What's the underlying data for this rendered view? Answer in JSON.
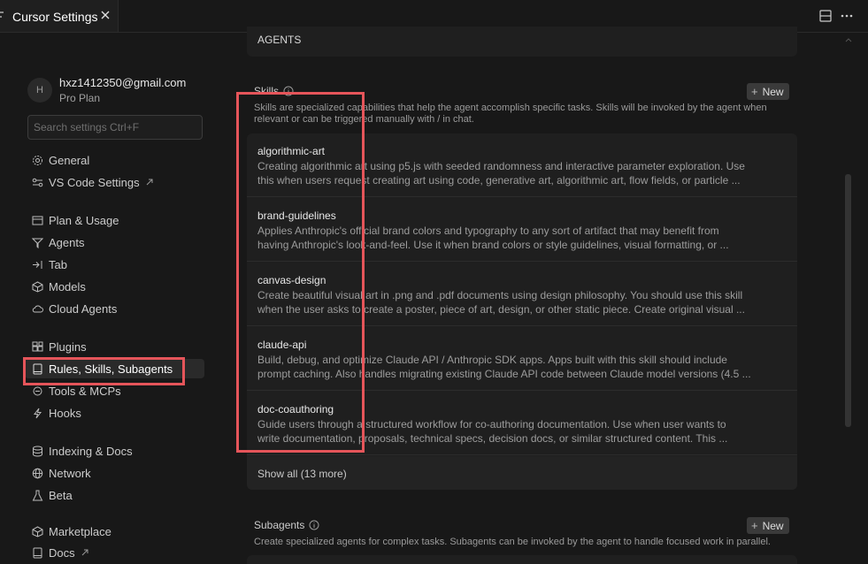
{
  "tab": {
    "title": "Cursor Settings"
  },
  "user": {
    "avatar_initial": "H",
    "email": "hxz1412350@gmail.com",
    "plan": "Pro Plan"
  },
  "search": {
    "placeholder": "Search settings Ctrl+F"
  },
  "sidebar": {
    "items": [
      {
        "label": "General",
        "icon": "gear-icon"
      },
      {
        "label": "VS Code Settings",
        "icon": "vscode-settings-icon"
      },
      {
        "label": "Plan & Usage",
        "icon": "plan-icon"
      },
      {
        "label": "Agents",
        "icon": "agents-icon"
      },
      {
        "label": "Tab",
        "icon": "tab-icon"
      },
      {
        "label": "Models",
        "icon": "cube-icon"
      },
      {
        "label": "Cloud Agents",
        "icon": "cloud-icon"
      },
      {
        "label": "Plugins",
        "icon": "plugins-icon"
      },
      {
        "label": "Rules, Skills, Subagents",
        "icon": "book-icon"
      },
      {
        "label": "Tools & MCPs",
        "icon": "tools-icon"
      },
      {
        "label": "Hooks",
        "icon": "hooks-icon"
      },
      {
        "label": "Indexing & Docs",
        "icon": "database-icon"
      },
      {
        "label": "Network",
        "icon": "globe-icon"
      },
      {
        "label": "Beta",
        "icon": "flask-icon"
      },
      {
        "label": "Marketplace",
        "icon": "marketplace-icon"
      },
      {
        "label": "Docs",
        "icon": "docs-icon"
      }
    ]
  },
  "main": {
    "agents_card": {
      "label": "AGENTS"
    },
    "skills": {
      "title": "Skills",
      "new_label": "New",
      "description": "Skills are specialized capabilities that help the agent accomplish specific tasks. Skills will be invoked by the agent when relevant or can be triggered manually with / in chat.",
      "items": [
        {
          "name": "algorithmic-art",
          "desc1": "Creating algorithmic art using p5.js with seeded randomness and interactive parameter exploration. Use",
          "desc2": "this when users request creating art using code, generative art, algorithmic art, flow fields, or particle ..."
        },
        {
          "name": "brand-guidelines",
          "desc1": "Applies Anthropic's official brand colors and typography to any sort of artifact that may benefit from",
          "desc2": "having Anthropic's look-and-feel. Use it when brand colors or style guidelines, visual formatting, or ..."
        },
        {
          "name": "canvas-design",
          "desc1": "Create beautiful visual art in .png and .pdf documents using design philosophy. You should use this skill",
          "desc2": "when the user asks to create a poster, piece of art, design, or other static piece. Create original visual ..."
        },
        {
          "name": "claude-api",
          "desc1": "Build, debug, and optimize Claude API / Anthropic SDK apps. Apps built with this skill should include",
          "desc2": "prompt caching. Also handles migrating existing Claude API code between Claude model versions (4.5 ..."
        },
        {
          "name": "doc-coauthoring",
          "desc1": "Guide users through a structured workflow for co-authoring documentation. Use when user wants to",
          "desc2": "write documentation, proposals, technical specs, decision docs, or similar structured content. This ..."
        }
      ],
      "show_all": "Show all (13 more)"
    },
    "subagents": {
      "title": "Subagents",
      "new_label": "New",
      "description": "Create specialized agents for complex tasks. Subagents can be invoked by the agent to handle focused work in parallel."
    }
  },
  "colors": {
    "highlight": "#e5555a",
    "background": "#181818",
    "card": "#1f1f1f"
  }
}
